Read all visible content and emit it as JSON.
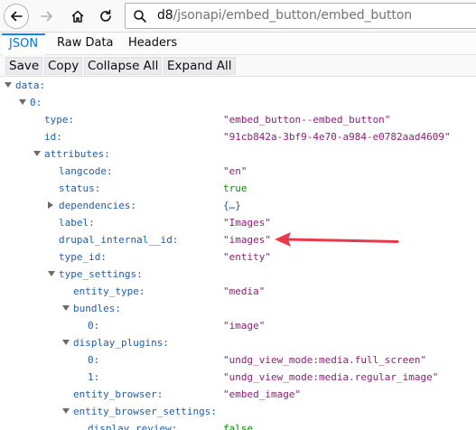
{
  "browser": {
    "url_host": "d8",
    "url_path": "/jsonapi/embed_button/embed_button"
  },
  "tabs": [
    {
      "label": "JSON",
      "selected": true
    },
    {
      "label": "Raw Data",
      "selected": false
    },
    {
      "label": "Headers",
      "selected": false
    }
  ],
  "toolbar": {
    "save": "Save",
    "copy": "Copy",
    "collapse_all": "Collapse All",
    "expand_all": "Expand All"
  },
  "tree": [
    {
      "key": "data:",
      "value": "",
      "kind": "obj",
      "depth": 0,
      "twisty": "open"
    },
    {
      "key": "0:",
      "value": "",
      "kind": "obj",
      "depth": 1,
      "twisty": "open"
    },
    {
      "key": "type:",
      "value": "\"embed_button--embed_button\"",
      "kind": "str",
      "depth": 2,
      "twisty": "none"
    },
    {
      "key": "id:",
      "value": "\"91cb842a-3bf9-4e70-a984-e0782aad4609\"",
      "kind": "str",
      "depth": 2,
      "twisty": "none"
    },
    {
      "key": "attributes:",
      "value": "",
      "kind": "obj",
      "depth": 2,
      "twisty": "open"
    },
    {
      "key": "langcode:",
      "value": "\"en\"",
      "kind": "str",
      "depth": 3,
      "twisty": "none"
    },
    {
      "key": "status:",
      "value": "true",
      "kind": "bool",
      "depth": 3,
      "twisty": "none"
    },
    {
      "key": "dependencies:",
      "value": "{…}",
      "kind": "obj",
      "depth": 3,
      "twisty": "closed"
    },
    {
      "key": "label:",
      "value": "\"Images\"",
      "kind": "str",
      "depth": 3,
      "twisty": "none"
    },
    {
      "key": "drupal_internal__id:",
      "value": "\"images\"",
      "kind": "str",
      "depth": 3,
      "twisty": "none"
    },
    {
      "key": "type_id:",
      "value": "\"entity\"",
      "kind": "str",
      "depth": 3,
      "twisty": "none"
    },
    {
      "key": "type_settings:",
      "value": "",
      "kind": "obj",
      "depth": 3,
      "twisty": "open"
    },
    {
      "key": "entity_type:",
      "value": "\"media\"",
      "kind": "str",
      "depth": 4,
      "twisty": "none"
    },
    {
      "key": "bundles:",
      "value": "",
      "kind": "obj",
      "depth": 4,
      "twisty": "open"
    },
    {
      "key": "0:",
      "value": "\"image\"",
      "kind": "str",
      "depth": 5,
      "twisty": "none"
    },
    {
      "key": "display_plugins:",
      "value": "",
      "kind": "obj",
      "depth": 4,
      "twisty": "open"
    },
    {
      "key": "0:",
      "value": "\"undg_view_mode:media.full_screen\"",
      "kind": "str",
      "depth": 5,
      "twisty": "none"
    },
    {
      "key": "1:",
      "value": "\"undg_view_mode:media.regular_image\"",
      "kind": "str",
      "depth": 5,
      "twisty": "none"
    },
    {
      "key": "entity_browser:",
      "value": "\"embed_image\"",
      "kind": "str",
      "depth": 4,
      "twisty": "none"
    },
    {
      "key": "entity_browser_settings:",
      "value": "",
      "kind": "obj",
      "depth": 4,
      "twisty": "open"
    },
    {
      "key": "display_review:",
      "value": "false",
      "kind": "bool",
      "depth": 5,
      "twisty": "none"
    }
  ],
  "colors": {
    "key": "#1f5cad",
    "string": "#8e1c78",
    "boolean": "#058b00",
    "accent": "#0a84ff",
    "annotation_arrow": "#e8394a"
  }
}
